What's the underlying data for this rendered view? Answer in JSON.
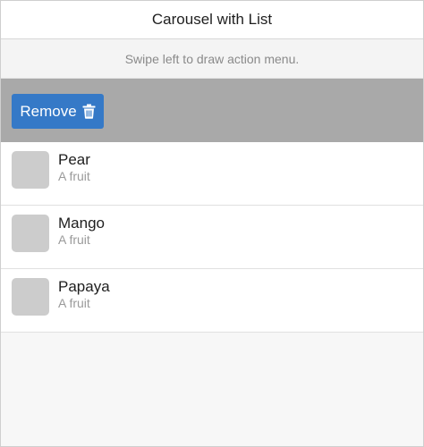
{
  "header": {
    "title": "Carousel with List"
  },
  "hint": {
    "text": "Swipe left to draw action menu."
  },
  "action": {
    "remove_label": "Remove",
    "icon": "trash-icon"
  },
  "list": {
    "items": [
      {
        "title": "Pear",
        "subtitle": "A fruit"
      },
      {
        "title": "Mango",
        "subtitle": "A fruit"
      },
      {
        "title": "Papaya",
        "subtitle": "A fruit"
      }
    ]
  },
  "colors": {
    "accent": "#3579c7",
    "action_bg": "#a9a9a9",
    "thumb": "#cccccc"
  }
}
